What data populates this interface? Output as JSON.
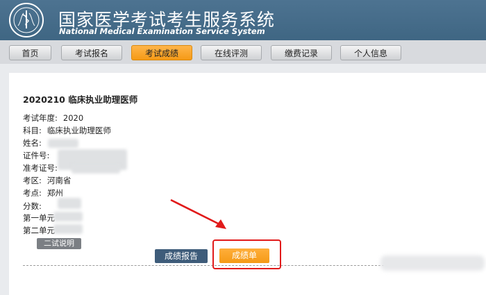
{
  "header": {
    "title_cn": "国家医学考试考生服务系统",
    "title_en": "National Medical Examination Service System"
  },
  "nav": {
    "items": [
      {
        "label": "首页"
      },
      {
        "label": "考试报名"
      },
      {
        "label": "考试成绩",
        "active": true
      },
      {
        "label": "在线评测"
      },
      {
        "label": "缴费记录"
      },
      {
        "label": "个人信息"
      }
    ]
  },
  "result": {
    "exam_title": "2020210  临床执业助理医师",
    "fields": [
      {
        "label": "考试年度:",
        "value": "2020"
      },
      {
        "label": "科目:",
        "value": "临床执业助理医师"
      },
      {
        "label": "姓名:",
        "value": ""
      },
      {
        "label": "证件号:",
        "value": ""
      },
      {
        "label": "准考证号:",
        "value": ""
      },
      {
        "label": "考区:",
        "value": "河南省"
      },
      {
        "label": "考点:",
        "value": "郑州"
      },
      {
        "label": "分数:",
        "value": ""
      },
      {
        "label": "第一单元",
        "value": ""
      },
      {
        "label": "第二单元",
        "value": ""
      }
    ],
    "second_exam_btn": "二试说明",
    "report_btn": "成绩报告",
    "scoresheet_btn": "成绩单"
  },
  "colors": {
    "header_bg": "#4a6f8c",
    "accent_orange": "#f59a16",
    "highlight_red": "#e11a1a",
    "report_btn": "#3e5c7a"
  }
}
